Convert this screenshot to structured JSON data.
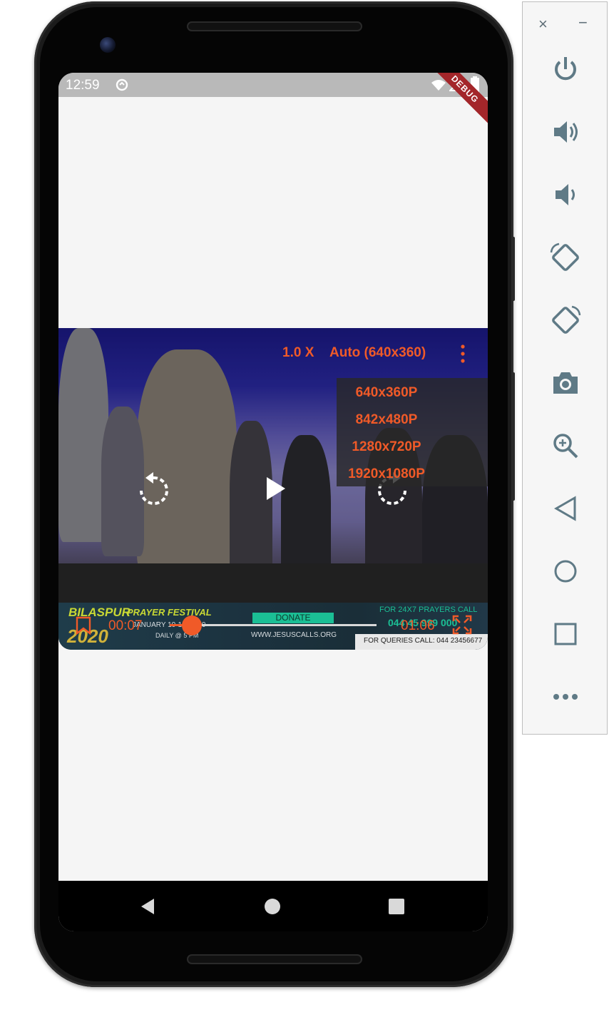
{
  "status_bar": {
    "time": "12:59",
    "debug_label": "DEBUG"
  },
  "player": {
    "speed": "1.0 X",
    "quality": "Auto (640x360)",
    "quality_options": [
      "640x360P",
      "842x480P",
      "1280x720P",
      "1920x1080P"
    ],
    "current_time": "00:07",
    "duration": "01:06",
    "progress": 0.106
  },
  "video_banner": {
    "title_left": "BILASPUR",
    "title_right": "PRAYER FESTIVAL",
    "year": "2020",
    "dates": "JANUARY 10-12, 2020",
    "daily": "DAILY @ 5 PM",
    "donate": "DONATE",
    "website": "WWW.JESUSCALLS.ORG",
    "prayer_call": "FOR 24X7 PRAYERS CALL",
    "phone": "044 45 999 000",
    "queries": "FOR QUERIES CALL: 044 23456677"
  },
  "emulator_panel": {
    "close": "×",
    "minimize": "−",
    "buttons": [
      "power-icon",
      "volume-up-icon",
      "volume-down-icon",
      "rotate-left-icon",
      "rotate-right-icon",
      "camera-icon",
      "zoom-icon",
      "back-icon",
      "home-icon",
      "overview-icon",
      "more-icon"
    ]
  },
  "colors": {
    "accent": "#f05a28",
    "status_bar": "#b9b9b9",
    "screen_bg": "#f5f5f5",
    "panel_icon": "#5f7a86"
  }
}
